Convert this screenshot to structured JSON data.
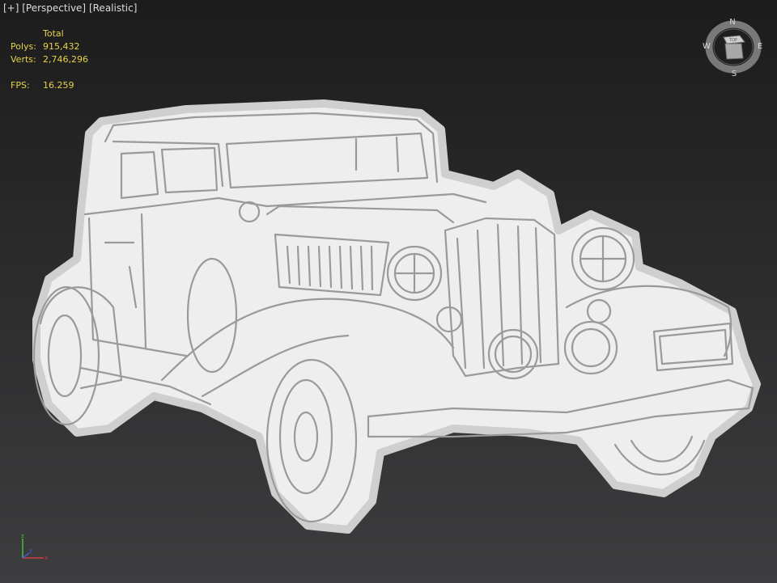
{
  "viewport": {
    "plus": "[+]",
    "view": "[Perspective]",
    "shading": "[Realistic]"
  },
  "stats": {
    "header": "Total",
    "polys_label": "Polys:",
    "polys_value": "915,432",
    "verts_label": "Verts:",
    "verts_value": "2,746,296",
    "fps_label": "FPS:",
    "fps_value": "16.259"
  },
  "viewcube": {
    "n": "N",
    "s": "S",
    "e": "E",
    "w": "W",
    "face": "TOP"
  },
  "axis": {
    "x": "x",
    "y": "y",
    "z": "z"
  },
  "colors": {
    "stats_text": "#e6d24a",
    "label_text": "#dcdcdc",
    "model_fill": "#efefef",
    "model_line": "#9a9a9a"
  }
}
